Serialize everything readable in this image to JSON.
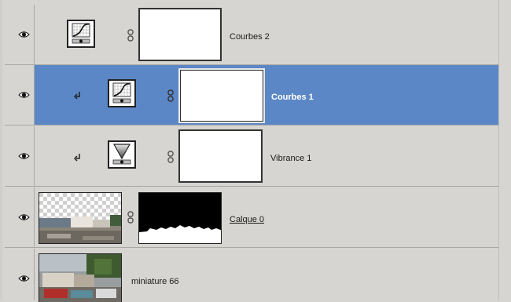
{
  "layers": [
    {
      "name": "Courbes 2",
      "type": "curves-adjustment",
      "selected": false,
      "clipped": false,
      "visible": true
    },
    {
      "name": "Courbes 1",
      "type": "curves-adjustment",
      "selected": true,
      "clipped": true,
      "visible": true
    },
    {
      "name": "Vibrance 1",
      "type": "vibrance-adjustment",
      "selected": false,
      "clipped": true,
      "visible": true
    },
    {
      "name": "Calque 0",
      "type": "image-with-mask",
      "selected": false,
      "clipped": false,
      "visible": true
    },
    {
      "name": "miniature 66",
      "type": "image",
      "selected": false,
      "clipped": false,
      "visible": true
    }
  ],
  "colors": {
    "panel_bg": "#d6d5d1",
    "selected_bg": "#5b87c6",
    "divider": "#a9a8a4"
  },
  "icons": [
    "eye-icon",
    "clip-arrow-icon",
    "curves-icon",
    "vibrance-icon",
    "chain-link-icon"
  ]
}
